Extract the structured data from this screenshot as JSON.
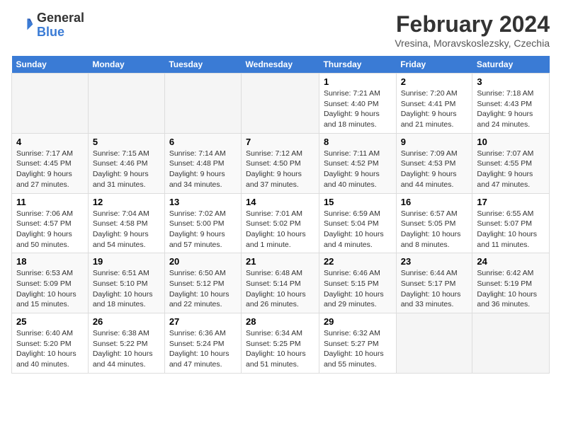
{
  "header": {
    "logo_general": "General",
    "logo_blue": "Blue",
    "month_title": "February 2024",
    "location": "Vresina, Moravskoslezsky, Czechia"
  },
  "days_of_week": [
    "Sunday",
    "Monday",
    "Tuesday",
    "Wednesday",
    "Thursday",
    "Friday",
    "Saturday"
  ],
  "weeks": [
    [
      {
        "day": "",
        "info": ""
      },
      {
        "day": "",
        "info": ""
      },
      {
        "day": "",
        "info": ""
      },
      {
        "day": "",
        "info": ""
      },
      {
        "day": "1",
        "info": "Sunrise: 7:21 AM\nSunset: 4:40 PM\nDaylight: 9 hours\nand 18 minutes."
      },
      {
        "day": "2",
        "info": "Sunrise: 7:20 AM\nSunset: 4:41 PM\nDaylight: 9 hours\nand 21 minutes."
      },
      {
        "day": "3",
        "info": "Sunrise: 7:18 AM\nSunset: 4:43 PM\nDaylight: 9 hours\nand 24 minutes."
      }
    ],
    [
      {
        "day": "4",
        "info": "Sunrise: 7:17 AM\nSunset: 4:45 PM\nDaylight: 9 hours\nand 27 minutes."
      },
      {
        "day": "5",
        "info": "Sunrise: 7:15 AM\nSunset: 4:46 PM\nDaylight: 9 hours\nand 31 minutes."
      },
      {
        "day": "6",
        "info": "Sunrise: 7:14 AM\nSunset: 4:48 PM\nDaylight: 9 hours\nand 34 minutes."
      },
      {
        "day": "7",
        "info": "Sunrise: 7:12 AM\nSunset: 4:50 PM\nDaylight: 9 hours\nand 37 minutes."
      },
      {
        "day": "8",
        "info": "Sunrise: 7:11 AM\nSunset: 4:52 PM\nDaylight: 9 hours\nand 40 minutes."
      },
      {
        "day": "9",
        "info": "Sunrise: 7:09 AM\nSunset: 4:53 PM\nDaylight: 9 hours\nand 44 minutes."
      },
      {
        "day": "10",
        "info": "Sunrise: 7:07 AM\nSunset: 4:55 PM\nDaylight: 9 hours\nand 47 minutes."
      }
    ],
    [
      {
        "day": "11",
        "info": "Sunrise: 7:06 AM\nSunset: 4:57 PM\nDaylight: 9 hours\nand 50 minutes."
      },
      {
        "day": "12",
        "info": "Sunrise: 7:04 AM\nSunset: 4:58 PM\nDaylight: 9 hours\nand 54 minutes."
      },
      {
        "day": "13",
        "info": "Sunrise: 7:02 AM\nSunset: 5:00 PM\nDaylight: 9 hours\nand 57 minutes."
      },
      {
        "day": "14",
        "info": "Sunrise: 7:01 AM\nSunset: 5:02 PM\nDaylight: 10 hours\nand 1 minute."
      },
      {
        "day": "15",
        "info": "Sunrise: 6:59 AM\nSunset: 5:04 PM\nDaylight: 10 hours\nand 4 minutes."
      },
      {
        "day": "16",
        "info": "Sunrise: 6:57 AM\nSunset: 5:05 PM\nDaylight: 10 hours\nand 8 minutes."
      },
      {
        "day": "17",
        "info": "Sunrise: 6:55 AM\nSunset: 5:07 PM\nDaylight: 10 hours\nand 11 minutes."
      }
    ],
    [
      {
        "day": "18",
        "info": "Sunrise: 6:53 AM\nSunset: 5:09 PM\nDaylight: 10 hours\nand 15 minutes."
      },
      {
        "day": "19",
        "info": "Sunrise: 6:51 AM\nSunset: 5:10 PM\nDaylight: 10 hours\nand 18 minutes."
      },
      {
        "day": "20",
        "info": "Sunrise: 6:50 AM\nSunset: 5:12 PM\nDaylight: 10 hours\nand 22 minutes."
      },
      {
        "day": "21",
        "info": "Sunrise: 6:48 AM\nSunset: 5:14 PM\nDaylight: 10 hours\nand 26 minutes."
      },
      {
        "day": "22",
        "info": "Sunrise: 6:46 AM\nSunset: 5:15 PM\nDaylight: 10 hours\nand 29 minutes."
      },
      {
        "day": "23",
        "info": "Sunrise: 6:44 AM\nSunset: 5:17 PM\nDaylight: 10 hours\nand 33 minutes."
      },
      {
        "day": "24",
        "info": "Sunrise: 6:42 AM\nSunset: 5:19 PM\nDaylight: 10 hours\nand 36 minutes."
      }
    ],
    [
      {
        "day": "25",
        "info": "Sunrise: 6:40 AM\nSunset: 5:20 PM\nDaylight: 10 hours\nand 40 minutes."
      },
      {
        "day": "26",
        "info": "Sunrise: 6:38 AM\nSunset: 5:22 PM\nDaylight: 10 hours\nand 44 minutes."
      },
      {
        "day": "27",
        "info": "Sunrise: 6:36 AM\nSunset: 5:24 PM\nDaylight: 10 hours\nand 47 minutes."
      },
      {
        "day": "28",
        "info": "Sunrise: 6:34 AM\nSunset: 5:25 PM\nDaylight: 10 hours\nand 51 minutes."
      },
      {
        "day": "29",
        "info": "Sunrise: 6:32 AM\nSunset: 5:27 PM\nDaylight: 10 hours\nand 55 minutes."
      },
      {
        "day": "",
        "info": ""
      },
      {
        "day": "",
        "info": ""
      }
    ]
  ]
}
